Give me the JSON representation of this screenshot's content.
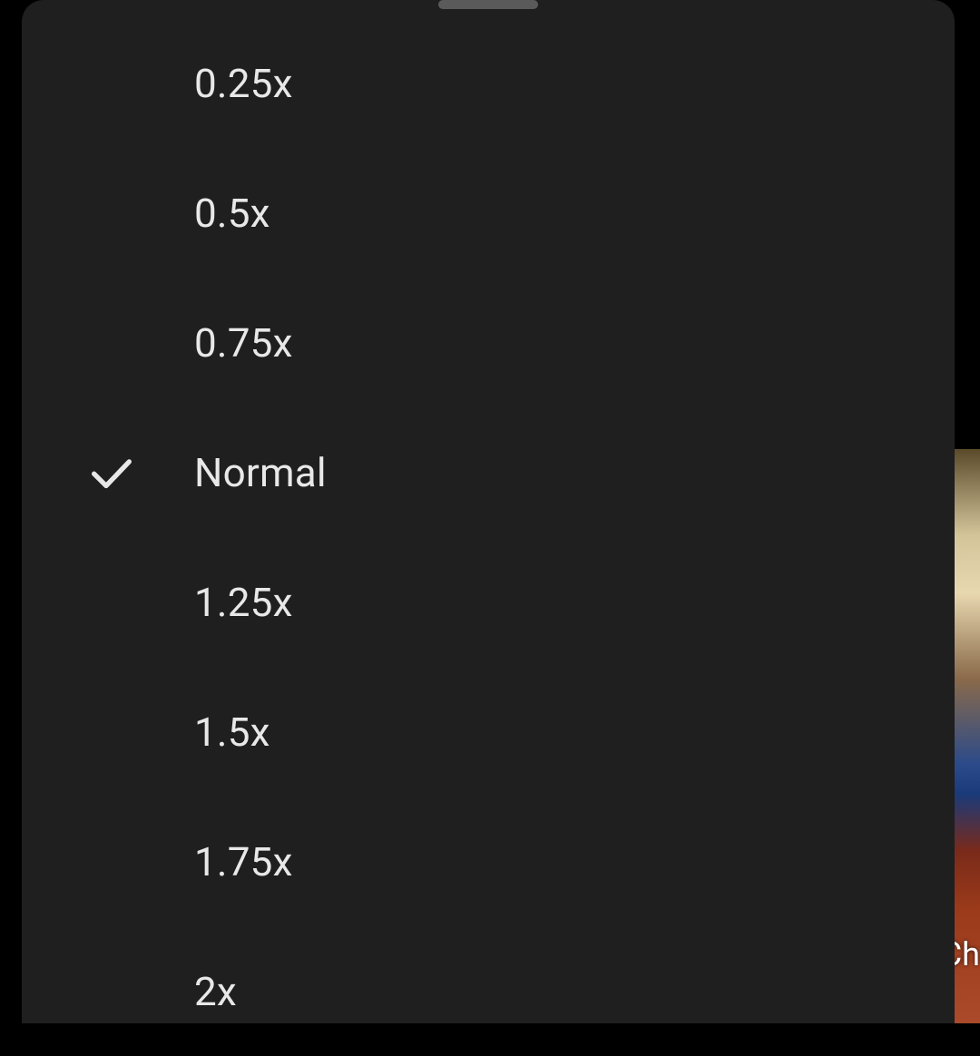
{
  "background": {
    "partial_text": "Ch"
  },
  "speed_menu": {
    "options": [
      {
        "label": "0.25x",
        "selected": false
      },
      {
        "label": "0.5x",
        "selected": false
      },
      {
        "label": "0.75x",
        "selected": false
      },
      {
        "label": "Normal",
        "selected": true
      },
      {
        "label": "1.25x",
        "selected": false
      },
      {
        "label": "1.5x",
        "selected": false
      },
      {
        "label": "1.75x",
        "selected": false
      },
      {
        "label": "2x",
        "selected": false
      }
    ]
  }
}
